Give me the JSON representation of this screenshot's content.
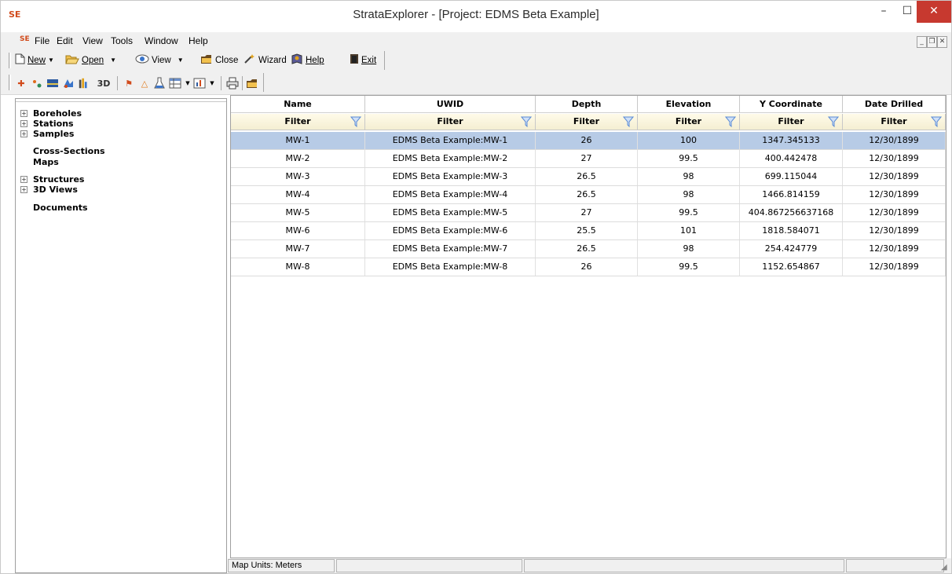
{
  "window": {
    "icon_label": "SE",
    "title": "StrataExplorer - [Project: EDMS Beta Example]",
    "controls": {
      "minimize": "–",
      "maximize": "☐",
      "close": "✕"
    }
  },
  "menubar": {
    "logo": "SE",
    "items": [
      "File",
      "Edit",
      "View",
      "Tools",
      "Window",
      "Help"
    ]
  },
  "toolbar1": {
    "new": "New",
    "open": "Open",
    "view": "View",
    "close": "Close",
    "wizard": "Wizard",
    "help": "Help",
    "exit": "Exit"
  },
  "toolbar2": {
    "three_d": "3D"
  },
  "tree": {
    "items": [
      {
        "label": "Boreholes",
        "expandable": true
      },
      {
        "label": "Stations",
        "expandable": true
      },
      {
        "label": "Samples",
        "expandable": true
      },
      {
        "label": "Cross-Sections",
        "expandable": false
      },
      {
        "label": "Maps",
        "expandable": false
      },
      {
        "label": "Structures",
        "expandable": true
      },
      {
        "label": "3D Views",
        "expandable": true
      },
      {
        "label": "Documents",
        "expandable": false
      }
    ]
  },
  "grid": {
    "columns": [
      "Name",
      "UWID",
      "Depth",
      "Elevation",
      "Y Coordinate",
      "Date Drilled"
    ],
    "filter_label": "Filter",
    "selected_row": 0,
    "rows": [
      [
        "MW-1",
        "EDMS Beta Example:MW-1",
        "26",
        "100",
        "1347.345133",
        "12/30/1899"
      ],
      [
        "MW-2",
        "EDMS Beta Example:MW-2",
        "27",
        "99.5",
        "400.442478",
        "12/30/1899"
      ],
      [
        "MW-3",
        "EDMS Beta Example:MW-3",
        "26.5",
        "98",
        "699.115044",
        "12/30/1899"
      ],
      [
        "MW-4",
        "EDMS Beta Example:MW-4",
        "26.5",
        "98",
        "1466.814159",
        "12/30/1899"
      ],
      [
        "MW-5",
        "EDMS Beta Example:MW-5",
        "27",
        "99.5",
        "404.867256637168",
        "12/30/1899"
      ],
      [
        "MW-6",
        "EDMS Beta Example:MW-6",
        "25.5",
        "101",
        "1818.584071",
        "12/30/1899"
      ],
      [
        "MW-7",
        "EDMS Beta Example:MW-7",
        "26.5",
        "98",
        "254.424779",
        "12/30/1899"
      ],
      [
        "MW-8",
        "EDMS Beta Example:MW-8",
        "26",
        "99.5",
        "1152.654867",
        "12/30/1899"
      ]
    ]
  },
  "statusbar": {
    "map_units": "Map Units: Meters"
  },
  "colors": {
    "selected_row": "#b7cbe6",
    "close_button": "#c7392f",
    "filter_row": "#fffbe9",
    "funnel": "#5b8bd4",
    "logo": "#d14b1c"
  }
}
